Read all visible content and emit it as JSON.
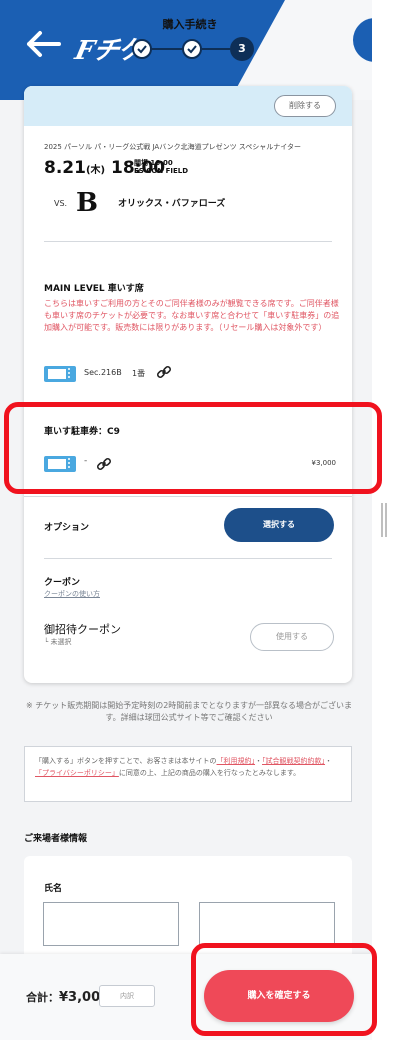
{
  "header": {
    "step_title": "購入手続き",
    "logo_text": "Fチケ",
    "current_step": "3",
    "colors": {
      "brand_blue": "#1b5fb3",
      "navy": "#0e2f57"
    }
  },
  "card": {
    "delete_label": "削除する",
    "event_line": "2025 パーソル パ・リーグ公式戦 JAバンク北海道プレゼンツ スペシャルナイター",
    "date": "8.21",
    "weekday": "(木)",
    "time": "18:00",
    "open_label": "開場 16:00",
    "venue": "ES CON FIELD",
    "vs": "VS.",
    "team_logo": "B",
    "team_name": "オリックス・バファローズ",
    "seat": {
      "title": "MAIN LEVEL 車いす席",
      "note": "こちらは車いすご利用の方とそのご同伴者様のみが観覧できる席です。ご同伴者様も車いす席のチケットが必要です。なお車いす席と合わせて「車いす駐車券」の追加購入が可能です。販売数には限りがあります。（リセール購入は対象外です）",
      "section": "Sec.216B",
      "count": "1番"
    },
    "parking": {
      "title": "車いす駐車券：C9",
      "dash": "-",
      "price": "¥3,000"
    },
    "option": {
      "label": "オプション",
      "button": "選択する"
    },
    "coupon": {
      "label": "クーポン",
      "link": "クーポンの使い方",
      "invite_label": "御招待クーポン",
      "invite_status": "└ 未選択",
      "use_button": "使用する"
    }
  },
  "notice": "※ チケット販売期間は開始予定時刻の2時間前までとなりますが一部異なる場合がございます。詳細は球団公式サイト等でご確認ください",
  "terms": {
    "pre": "「購入する」ボタンを押すことで、お客さまは本サイトの",
    "link1": "「利用規約」",
    "mid1": "・",
    "link2": "「試合観戦契約約款」",
    "mid2": "・",
    "link3": "「プライバシーポリシー」",
    "post": "に同意の上、上記の商品の購入を行なったとみなします。"
  },
  "visitor": {
    "title": "ご来場者様情報",
    "name_label": "氏名"
  },
  "footer": {
    "total_label": "合計：",
    "total_value": "¥3,000",
    "detail_button": "内訳",
    "confirm_button": "購入を確定する",
    "confirm_color": "#ef4958"
  }
}
